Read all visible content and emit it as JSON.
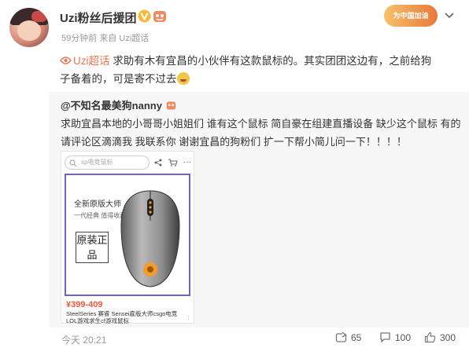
{
  "header": {
    "user_name": "Uzi粉丝后援团",
    "time_ago": "59分钟前",
    "source_prefix": "来自",
    "source": "Uzi超话",
    "banner_text": "为中国加油"
  },
  "post": {
    "topic": "Uzi超话",
    "text_line1": " 求助有木有宜昌的小伙伴有这款鼠标的。其实团团这边有，之前给狗",
    "text_line2": "子备着的，可是寄不过去"
  },
  "repost": {
    "author": "@不知名最美狗nanny",
    "text": "求助宜昌本地的小哥哥小姐姐们 谁有这个鼠标 简自豪在组建直播设备 缺少这个鼠标 有的请评论区滴滴我 我联系你 谢谢宜昌的狗粉们 扩一下帮小简儿问一下！！！！",
    "image": {
      "search_placeholder": "sp电竞鼠标",
      "promo_line1": "全新原版大师",
      "promo_line2": "一代经典 值得收藏",
      "genuine_label": "原装正品",
      "price": "¥399-409",
      "product_title": "SteelSeries 赛睿 Sensei雇版大师csgo电竞LOL游戏求生cf游戏鼠标"
    }
  },
  "footer": {
    "time": "今天 20:21",
    "repost_count": "65",
    "comment_count": "100",
    "like_count": "300"
  },
  "colors": {
    "topic": "#eb7350",
    "price": "#f0583a",
    "frame": "#6f62c9"
  }
}
